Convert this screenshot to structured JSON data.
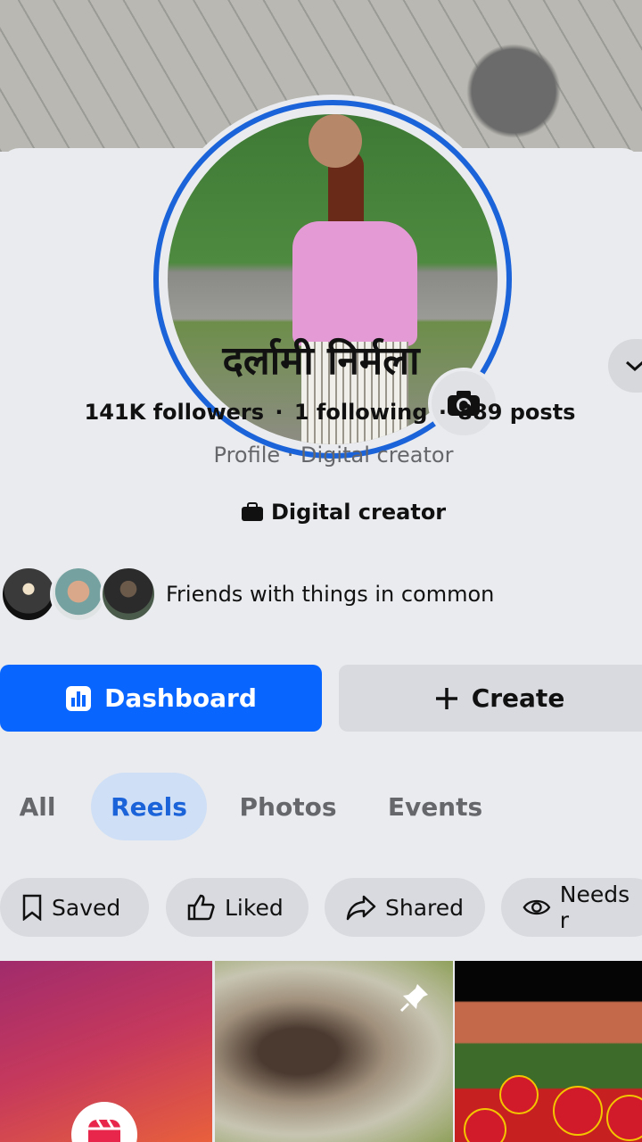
{
  "profile": {
    "name": "दर्लामी निर्मला",
    "followers": "141K followers",
    "following": "1 following",
    "posts": "889 posts",
    "separator": "·",
    "subtitle": "Profile · Digital creator",
    "category": "Digital creator",
    "friends_text": "Friends with things in common"
  },
  "actions": {
    "dashboard_label": "Dashboard",
    "create_label": "Create"
  },
  "tabs": [
    {
      "label": "All",
      "active": false
    },
    {
      "label": "Reels",
      "active": true
    },
    {
      "label": "Photos",
      "active": false
    },
    {
      "label": "Events",
      "active": false
    }
  ],
  "chips": [
    {
      "label": "Saved",
      "icon": "bookmark-icon"
    },
    {
      "label": "Liked",
      "icon": "thumbs-up-icon"
    },
    {
      "label": "Shared",
      "icon": "share-icon"
    },
    {
      "label": "Needs r",
      "icon": "eye-icon"
    }
  ],
  "colors": {
    "accent": "#0866ff",
    "ring": "#1b63d9",
    "background": "#e9ebee"
  }
}
